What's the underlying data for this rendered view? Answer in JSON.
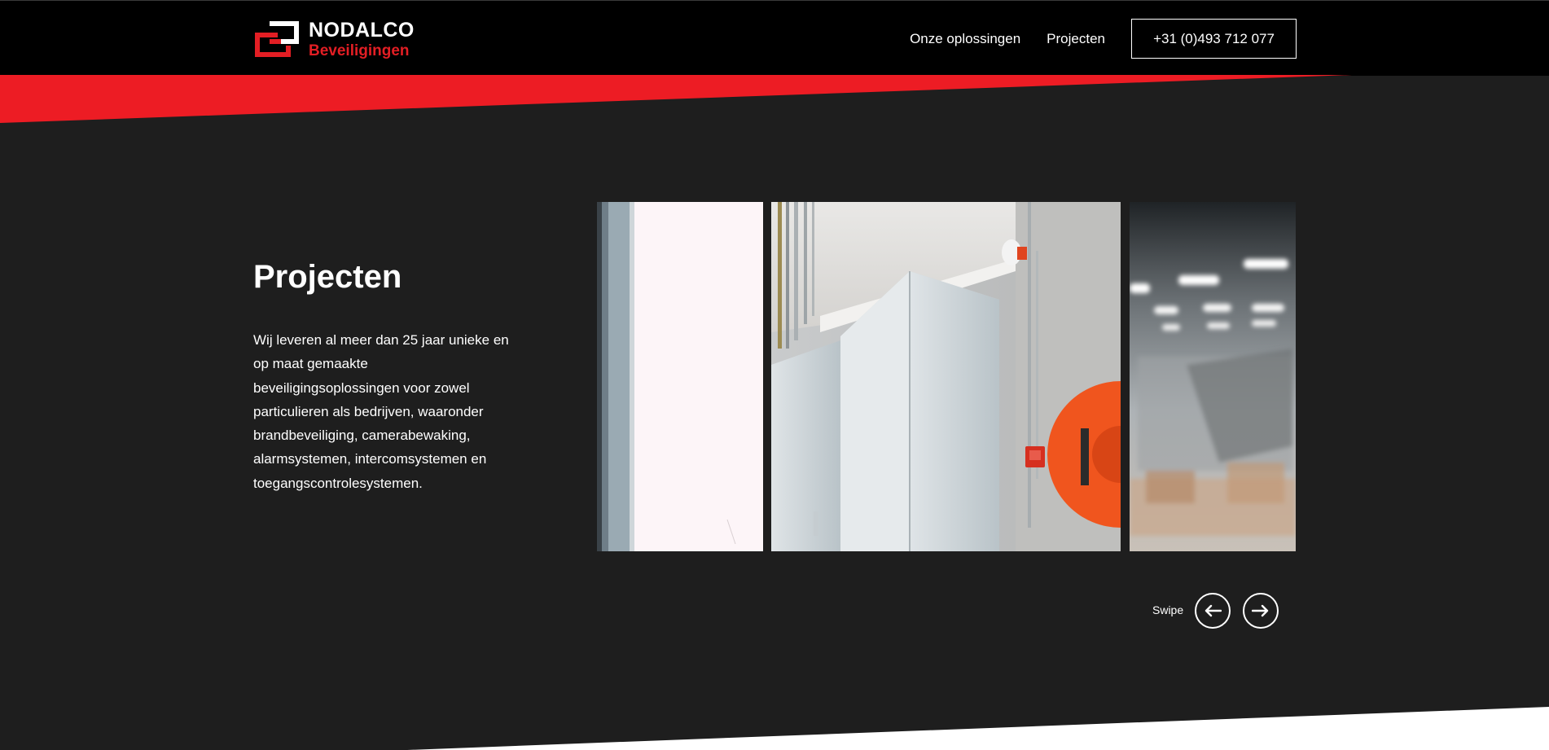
{
  "header": {
    "logo": {
      "name": "NODALCO",
      "subtitle": "Beveiligingen",
      "icon": "nodalco-logo-icon"
    },
    "nav": {
      "items": [
        {
          "label": "Onze oplossingen"
        },
        {
          "label": "Projecten"
        }
      ],
      "phone": "+31 (0)493 712 077"
    }
  },
  "hero": {
    "title": "Projecten",
    "description": "Wij leveren al meer dan 25 jaar unieke en op maat gemaakte beveiligingsoplossingen voor zowel particulieren als bedrijven, waaronder brandbeveiliging, camerabewaking, alarmsystemen, intercomsystemen en toegangscontrolesystemen."
  },
  "slider": {
    "slides": [
      {
        "name": "slide-window-image"
      },
      {
        "name": "slide-electrical-cabinets-fire-hose-image"
      },
      {
        "name": "slide-warehouse-blurred-image"
      }
    ],
    "swipe_label": "Swipe",
    "prev_icon": "arrow-left-icon",
    "next_icon": "arrow-right-icon"
  },
  "colors": {
    "brand_red": "#e31e24",
    "header_bg": "#000000",
    "page_bg": "#1e1e1e",
    "text": "#ffffff"
  }
}
